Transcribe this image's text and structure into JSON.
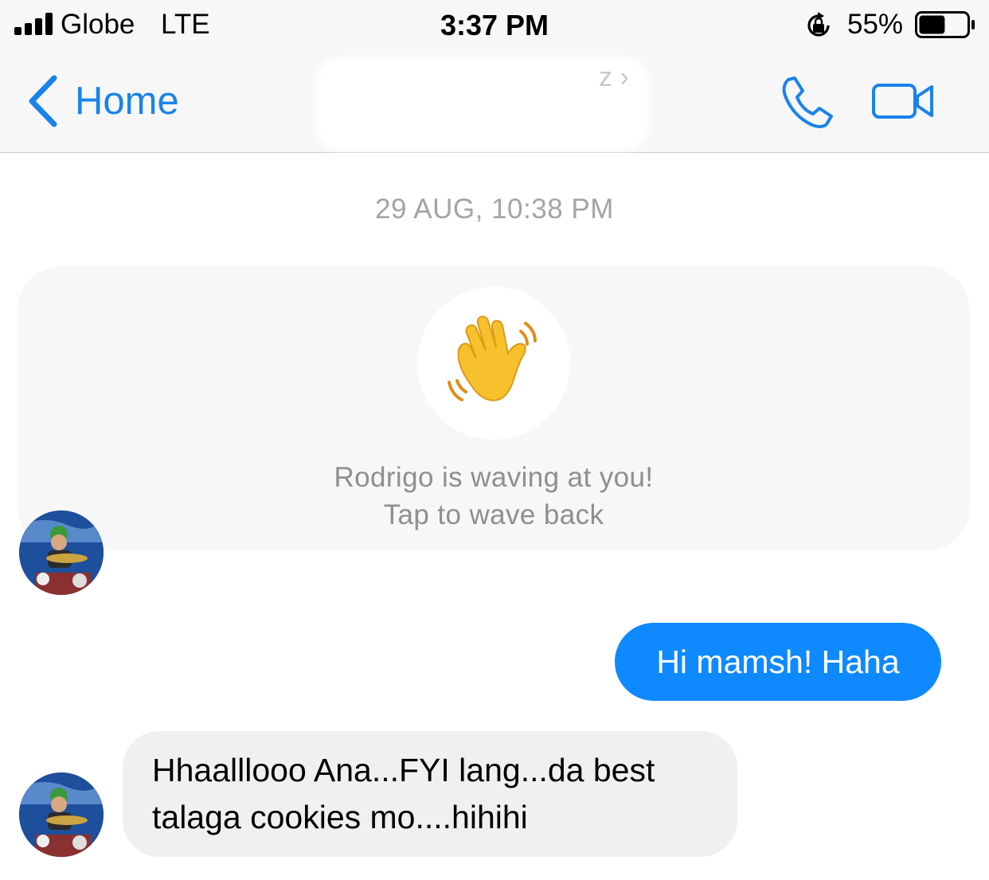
{
  "status_bar": {
    "carrier": "Globe",
    "network": "LTE",
    "time": "3:37 PM",
    "battery_percent": "55%",
    "battery_level": 0.55,
    "icons": [
      "signal-bars-icon",
      "rotation-lock-icon",
      "battery-icon"
    ]
  },
  "nav": {
    "back_label": "Home",
    "title_visible": "z",
    "icons": [
      "chevron-left-icon",
      "phone-icon",
      "video-camera-icon"
    ],
    "accent_color": "#1a83ea"
  },
  "conversation": {
    "timestamp": "29 AUG, 10:38 PM",
    "wave": {
      "emoji": "waving-hand-icon",
      "line1": "Rodrigo is waving at you!",
      "line2": "Tap to wave back"
    },
    "messages": [
      {
        "direction": "outgoing",
        "lines": [
          "Hi mamsh! Haha"
        ],
        "color": "#0f89fe"
      },
      {
        "direction": "incoming",
        "lines": [
          "Hhaalllooo Ana...FYI lang...da best",
          "talaga cookies mo....hihihi"
        ],
        "color": "#f1f0f0"
      }
    ]
  }
}
